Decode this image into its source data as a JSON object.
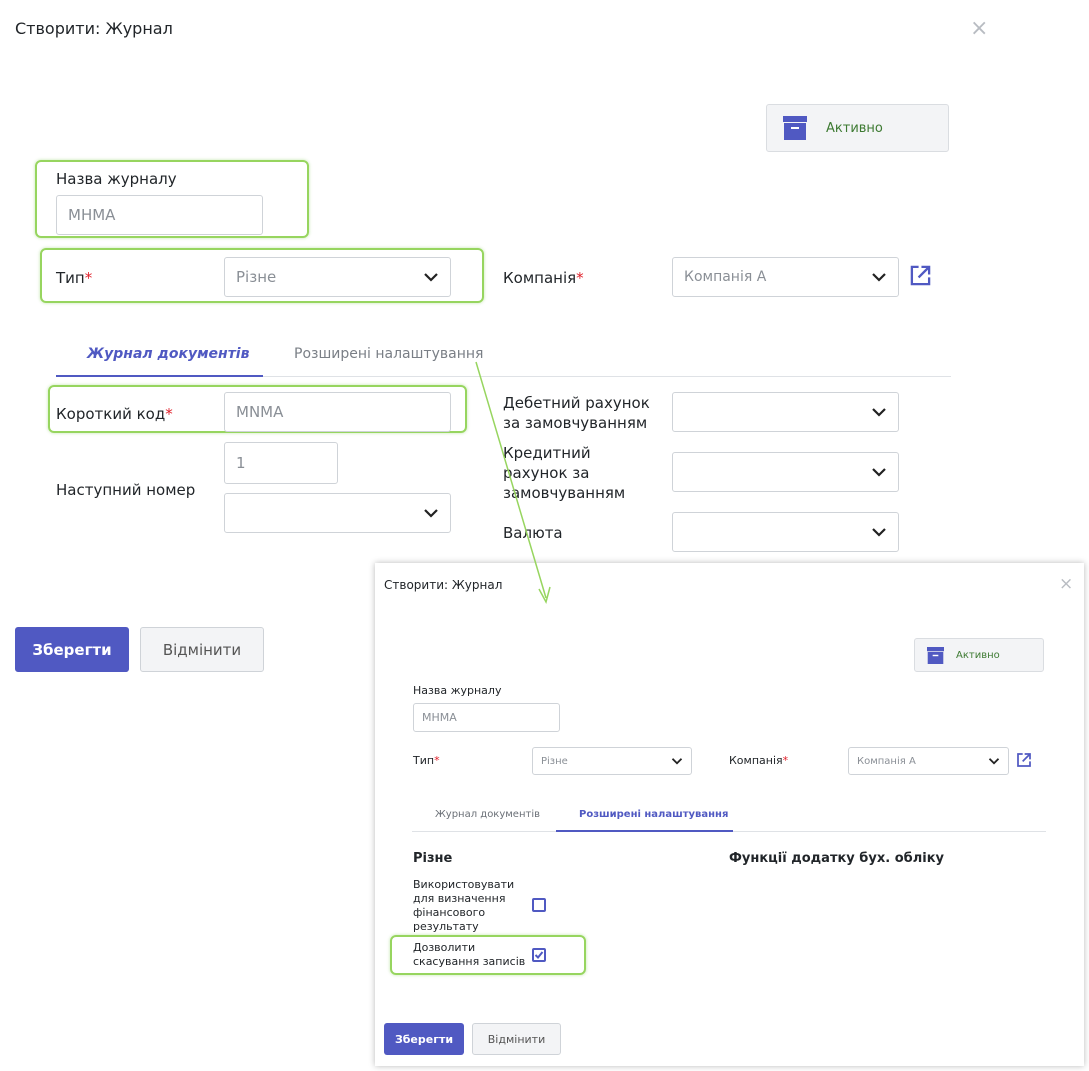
{
  "main": {
    "title": "Створити: Журнал",
    "close_symbol": "×",
    "status_label": "Активно",
    "name_label": "Назва журналу",
    "name_value": "МНМА",
    "type_label": "Тип",
    "type_value": "Різне",
    "company_label": "Компанія",
    "company_value": "Компанія А",
    "required_mark": "*",
    "tabs": [
      {
        "label": "Журнал документів",
        "active": true
      },
      {
        "label": "Розширені налаштування",
        "active": false
      }
    ],
    "short_code_label": "Короткий код",
    "short_code_value": "MNMA",
    "next_number_label": "Наступний номер",
    "next_number_value": "1",
    "next_number_sequence_value": "",
    "debit_label": "Дебетний рахунок за замовчуванням",
    "debit_value": "",
    "credit_label": "Кредитний рахунок за замовчуванням",
    "credit_value": "",
    "currency_label": "Валюта",
    "currency_value": "",
    "save_label": "Зберегти",
    "cancel_label": "Відмінити"
  },
  "inset": {
    "title": "Створити: Журнал",
    "close_symbol": "×",
    "status_label": "Активно",
    "name_label": "Назва журналу",
    "name_value": "МНМА",
    "type_label": "Тип",
    "type_value": "Різне",
    "company_label": "Компанія",
    "company_value": "Компанія А",
    "required_mark": "*",
    "tabs": [
      {
        "label": "Журнал документів",
        "active": false
      },
      {
        "label": "Розширені налаштування",
        "active": true
      }
    ],
    "section_misc": "Різне",
    "section_accounting": "Функції додатку бух. обліку",
    "use_for_result_label": "Використовувати для визначення фінансового результату",
    "use_for_result_checked": false,
    "allow_cancel_label": "Дозволити скасування записів",
    "allow_cancel_checked": true,
    "save_label": "Зберегти",
    "cancel_label": "Відмінити"
  },
  "colors": {
    "accent": "#5059c2",
    "status_text": "#3d7a32",
    "highlight": "#97d55f",
    "required": "#e0202a"
  },
  "icons": [
    "close-icon",
    "archive-icon",
    "chevron-down-icon",
    "external-link-icon",
    "check-icon"
  ]
}
